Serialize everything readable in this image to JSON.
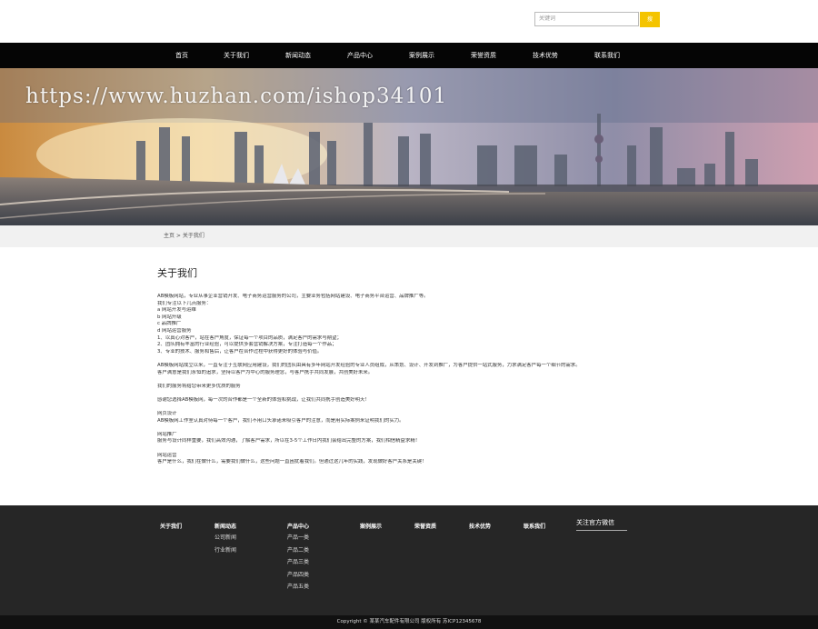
{
  "search": {
    "placeholder": "关键词",
    "button": "搜"
  },
  "nav": [
    "首页",
    "关于我们",
    "新闻动态",
    "产品中心",
    "案例展示",
    "荣誉资质",
    "技术优势",
    "联系我们"
  ],
  "banner": {
    "watermark": "https://www.huzhan.com/ishop34101"
  },
  "breadcrumb": "主页 > 关于我们",
  "about": {
    "title": "关于我们",
    "lines": [
      "AB模板网站，专业从事企业营销开发、电子商务运营服务的公司，主要业务包括网站建设、电子商务平台运营、品牌推广等。",
      "我们专注以下几点服务：",
      "a 网站开发与运维",
      "b 网站升级",
      "c 品牌推广",
      "d 网站运营服务",
      "1、以真心对客户，站在客户角度，保证每一个项目的品质，满足客户的需求与期望；",
      "2、团队拥有丰富的行业经验，可以提供多套营销解决方案，专注打造每一个作品；",
      "3、专业的技术、服务和售后，让客户在合作过程中获得更好的体验与价值。",
      "",
      "AB模板网站成立以来，一直专注于互联网应用建设，我们的团队由具有多年网站开发经验的专业人员组成，从策划、设计、开发到推广，为客户提供一站式服务，力求满足客户每一个细节的需求。",
      "客户满意是我们永恒的追求，坚持以客户为中心的服务理念，与客户携手共同发展，共创美好未来。",
      "",
      "我们的服务将给您带来更多优质的服务",
      "",
      "感谢您选择AB模板网，每一次的合作都是一个全新的体验和挑战，让我们共同携手创造美好明天！",
      "",
      "网页设计",
      "AB模板网工作室认真对待每一个客户，我们不用口头承诺来吸引客户的注意，而是用实际案例来证明我们的实力。",
      "",
      "网站推广",
      "服务与设计同样重要，我们高效沟通，了解客户需求，所以在3-5个工作日内我们会给出完整的方案，我们相信精益求精！",
      "",
      "网站运营",
      "客户是什么，我们在做什么，需要我们做什么，这些问题一直困扰着我们。但通过这几年的实践，发现做好客户关系是关键！"
    ]
  },
  "footer": {
    "columns": [
      {
        "heading": "关于我们",
        "links": []
      },
      {
        "heading": "新闻动态",
        "links": [
          "公司新闻",
          "行业新闻"
        ]
      },
      {
        "heading": "产品中心",
        "links": [
          "产品一类",
          "产品二类",
          "产品三类",
          "产品四类",
          "产品五类"
        ]
      },
      {
        "heading": "案例展示",
        "links": []
      },
      {
        "heading": "荣誉资质",
        "links": []
      },
      {
        "heading": "技术优势",
        "links": []
      },
      {
        "heading": "联系我们",
        "links": []
      }
    ],
    "wechat_title": "关注官方微信",
    "copyright": "Copyright © 某某汽车配件有限公司 版权所有 苏ICP12345678"
  },
  "colors": {
    "nav_bg": "#050505",
    "footer_bg": "#262626",
    "search_btn": "#f4c400",
    "copyright_bg": "#111111"
  }
}
